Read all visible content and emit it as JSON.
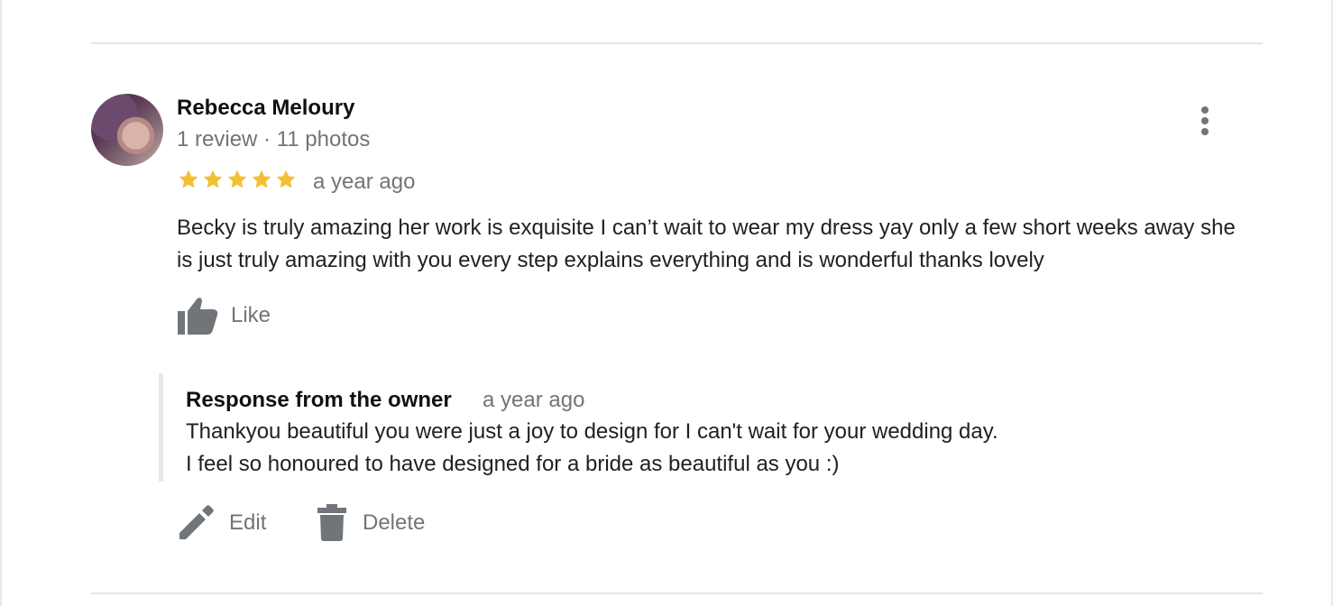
{
  "review": {
    "author_name": "Rebecca Meloury",
    "author_meta": "1 review · 11 photos",
    "rating": 5,
    "rating_max": 5,
    "time": "a year ago",
    "text": "Becky is truly amazing her work is exquisite I can’t wait to wear my dress yay only a few short weeks away she is just truly amazing with you every step explains everything and is wonderful thanks lovely",
    "like_label": "Like"
  },
  "owner_response": {
    "title": "Response from the owner",
    "time": "a year ago",
    "text": "Thankyou beautiful you were just a joy to design for I can't wait for your wedding day.\nI feel so honoured to have designed for a bride as beautiful as you :)"
  },
  "actions": {
    "edit_label": "Edit",
    "delete_label": "Delete"
  },
  "icons": {
    "star": "star-icon",
    "more": "more-vert-icon",
    "like": "thumb-up-icon",
    "edit": "pencil-icon",
    "delete": "trash-icon"
  },
  "colors": {
    "star": "#f4c033",
    "secondary_text": "#70757a",
    "primary_text": "#202124"
  }
}
